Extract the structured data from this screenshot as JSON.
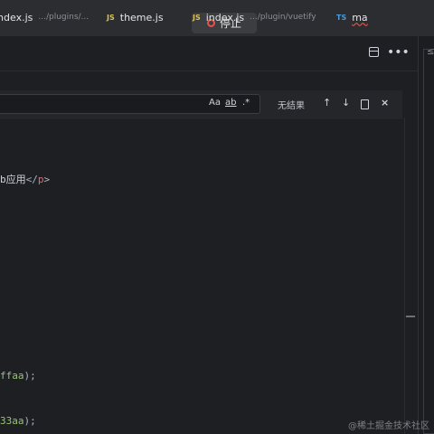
{
  "toolbar": {
    "stop_label": "停止"
  },
  "tabs": [
    {
      "badge": "",
      "name": "index.js",
      "path": ".../plugins/..."
    },
    {
      "badge": "JS",
      "name": "theme.js",
      "path": ""
    },
    {
      "badge": "JS",
      "name": "index.js",
      "path": ".../plugin/vuetify"
    },
    {
      "badge": "TS",
      "name": "ma",
      "path": ""
    }
  ],
  "find": {
    "query": "",
    "match_case": "Aa",
    "whole_word": "ab",
    "regex": ".*",
    "status": "无结果",
    "prev": "↑",
    "next": "↓",
    "close": "×"
  },
  "code": {
    "line1_text": "b应用",
    "line1_open": "</",
    "line1_tag": "p",
    "line1_close": ">",
    "line2_str": "ffaa",
    "line2_end": ");",
    "line3_str": "33aa",
    "line3_end": ");"
  },
  "watermark": "@稀土掘金技术社区",
  "right_pane_glyph": "≤"
}
